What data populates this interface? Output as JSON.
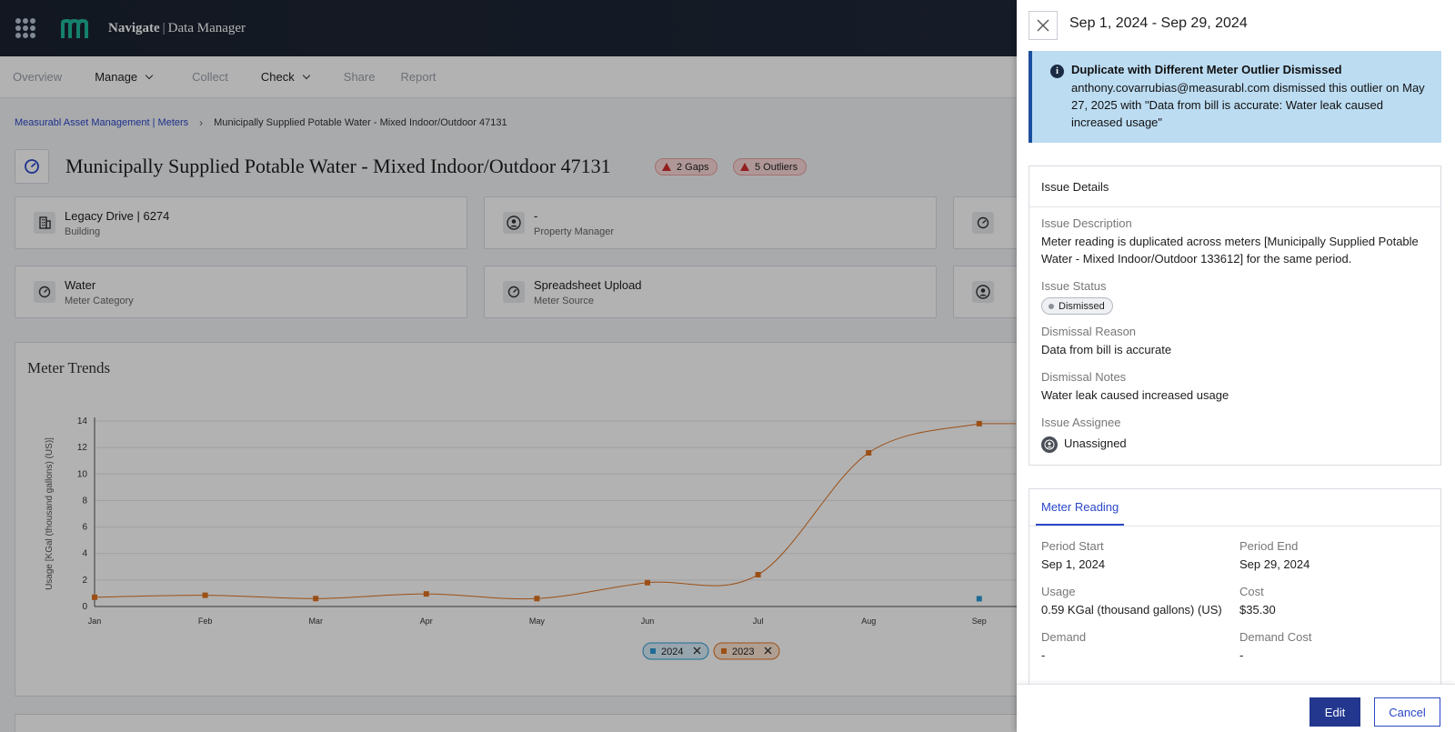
{
  "app": {
    "brand": "Navigate",
    "module": "Data Manager"
  },
  "nav": {
    "items": [
      {
        "label": "Overview",
        "state": "dim"
      },
      {
        "label": "Manage",
        "state": "active",
        "dropdown": true
      },
      {
        "label": "Collect",
        "state": "dim"
      },
      {
        "label": "Check",
        "state": "active",
        "dropdown": true
      },
      {
        "label": "Share",
        "state": "dim"
      },
      {
        "label": "Report",
        "state": "dim"
      }
    ]
  },
  "breadcrumb": {
    "root": "Measurabl Asset Management | Meters",
    "current": "Municipally Supplied Potable Water - Mixed Indoor/Outdoor 47131"
  },
  "page": {
    "title": "Municipally Supplied Potable Water - Mixed Indoor/Outdoor 47131",
    "gaps_badge": "2 Gaps",
    "outliers_badge": "5 Outliers"
  },
  "cards": [
    {
      "value": "Legacy Drive | 6274",
      "label": "Building",
      "icon": "building-icon"
    },
    {
      "value": "-",
      "label": "Property Manager",
      "icon": "user-icon"
    },
    {
      "value": "Water",
      "label": "Meter Category",
      "icon": "gauge-icon"
    },
    {
      "value": "Spreadsheet Upload",
      "label": "Meter Source",
      "icon": "gauge-icon"
    }
  ],
  "trends": {
    "title": "Meter Trends"
  },
  "chart_data": {
    "type": "line",
    "title": "Meter Trends",
    "xlabel": "",
    "ylabel": "Usage [KGal (thousand gallons) (US)]",
    "categories": [
      "Jan",
      "Feb",
      "Mar",
      "Apr",
      "May",
      "Jun",
      "Jul",
      "Aug",
      "Sep"
    ],
    "ylim": [
      0,
      14
    ],
    "yticks": [
      0,
      2,
      4,
      6,
      8,
      10,
      12,
      14
    ],
    "grid": true,
    "legend_position": "bottom",
    "series": [
      {
        "name": "2024",
        "color": "#2b9bd6",
        "values": [
          null,
          null,
          null,
          null,
          null,
          null,
          null,
          null,
          0.59
        ]
      },
      {
        "name": "2023",
        "color": "#e0711f",
        "values": [
          0.7,
          0.85,
          0.6,
          0.95,
          0.6,
          1.8,
          2.4,
          11.6,
          13.8
        ]
      }
    ]
  },
  "drawer": {
    "title": "Sep 1, 2024 - Sep 29, 2024",
    "alert": {
      "title": "Duplicate with Different Meter Outlier Dismissed",
      "body": "anthony.covarrubias@measurabl.com dismissed this outlier on May 27, 2025 with \"Data from bill is accurate: Water leak caused increased usage\""
    },
    "issue": {
      "heading": "Issue Details",
      "description_label": "Issue Description",
      "description": "Meter reading is duplicated across meters [Municipally Supplied Potable Water - Mixed Indoor/Outdoor 133612] for the same period.",
      "status_label": "Issue Status",
      "status": "Dismissed",
      "reason_label": "Dismissal Reason",
      "reason": "Data from bill is accurate",
      "notes_label": "Dismissal Notes",
      "notes": "Water leak caused increased usage",
      "assignee_label": "Issue Assignee",
      "assignee": "Unassigned"
    },
    "reading": {
      "tab": "Meter Reading",
      "period_start_label": "Period Start",
      "period_start": "Sep 1, 2024",
      "period_end_label": "Period End",
      "period_end": "Sep 29, 2024",
      "usage_label": "Usage",
      "usage": "0.59 KGal (thousand gallons) (US)",
      "cost_label": "Cost",
      "cost": "$35.30",
      "demand_label": "Demand",
      "demand": "-",
      "demand_cost_label": "Demand Cost",
      "demand_cost": "-"
    },
    "buttons": {
      "edit": "Edit",
      "cancel": "Cancel"
    }
  }
}
